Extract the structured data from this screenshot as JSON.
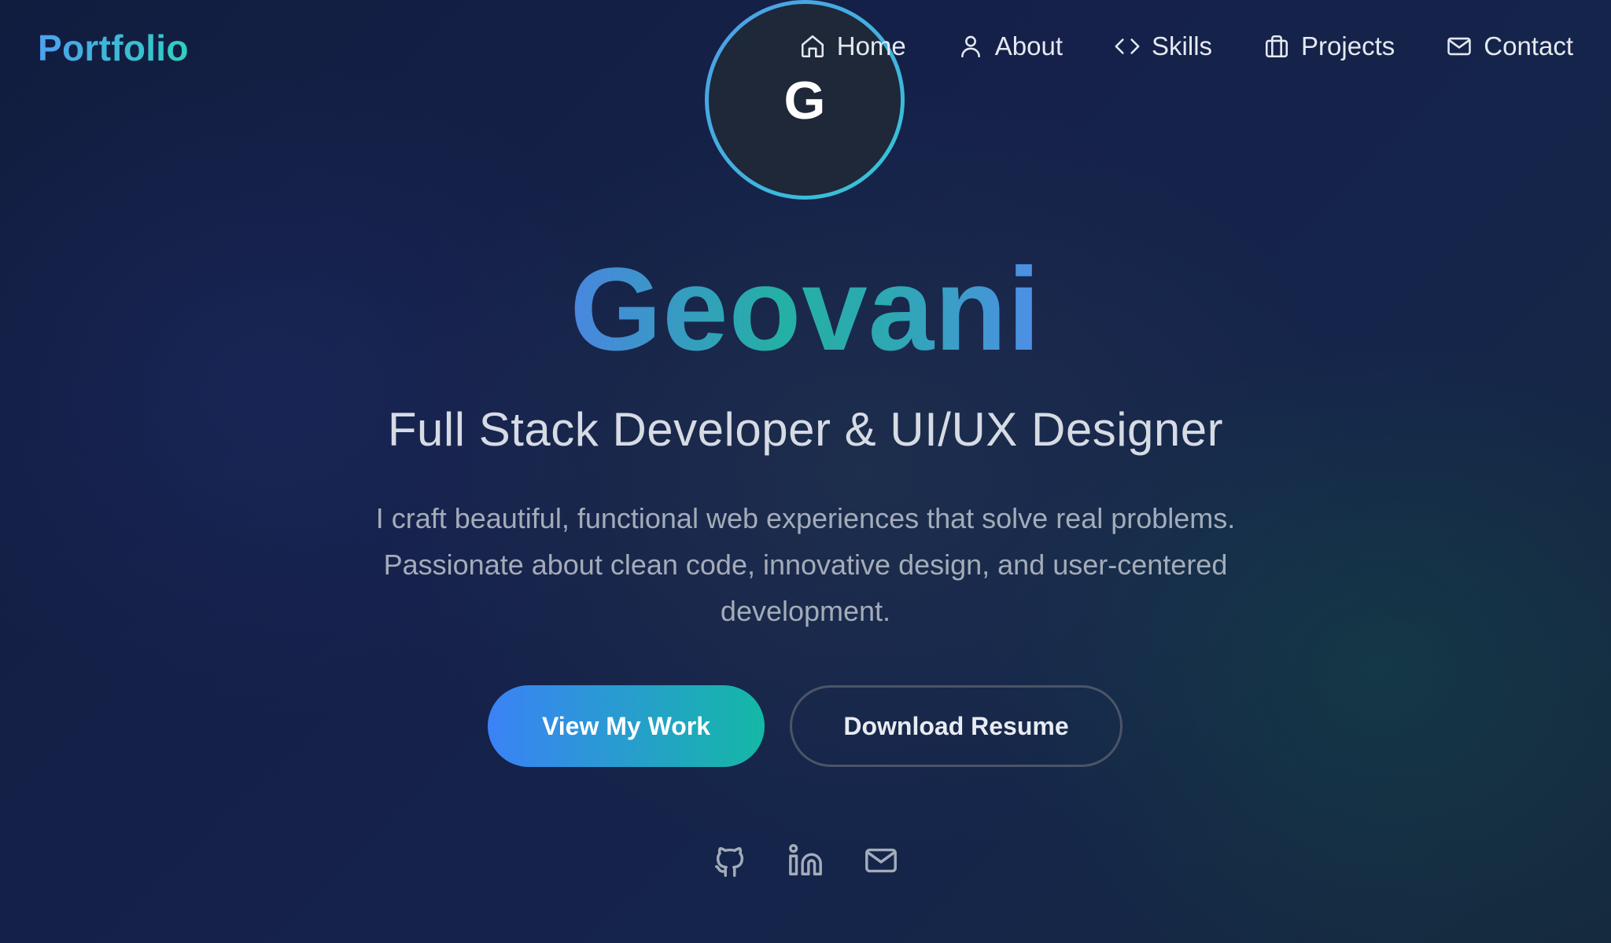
{
  "brand": "Portfolio",
  "nav": {
    "items": [
      {
        "label": "Home",
        "icon": "home-icon"
      },
      {
        "label": "About",
        "icon": "user-icon"
      },
      {
        "label": "Skills",
        "icon": "code-icon"
      },
      {
        "label": "Projects",
        "icon": "briefcase-icon"
      },
      {
        "label": "Contact",
        "icon": "mail-icon"
      }
    ]
  },
  "avatar": {
    "initial": "G"
  },
  "hero": {
    "name": "Geovani",
    "title": "Full Stack Developer & UI/UX Designer",
    "description_line1": "I craft beautiful, functional web experiences that solve real problems.",
    "description_line2": "Passionate about clean code, innovative design, and user-centered",
    "description_line3": "development."
  },
  "buttons": {
    "primary": "View My Work",
    "secondary": "Download Resume"
  },
  "social": [
    {
      "icon": "github-icon"
    },
    {
      "icon": "linkedin-icon"
    },
    {
      "icon": "mail-icon"
    }
  ],
  "colors": {
    "brand_gradient_start": "#4fa0f0",
    "brand_gradient_end": "#2ed1c0",
    "primary_button_start": "#3b82f6",
    "primary_button_end": "#14b8a6",
    "background": "#15214a"
  }
}
